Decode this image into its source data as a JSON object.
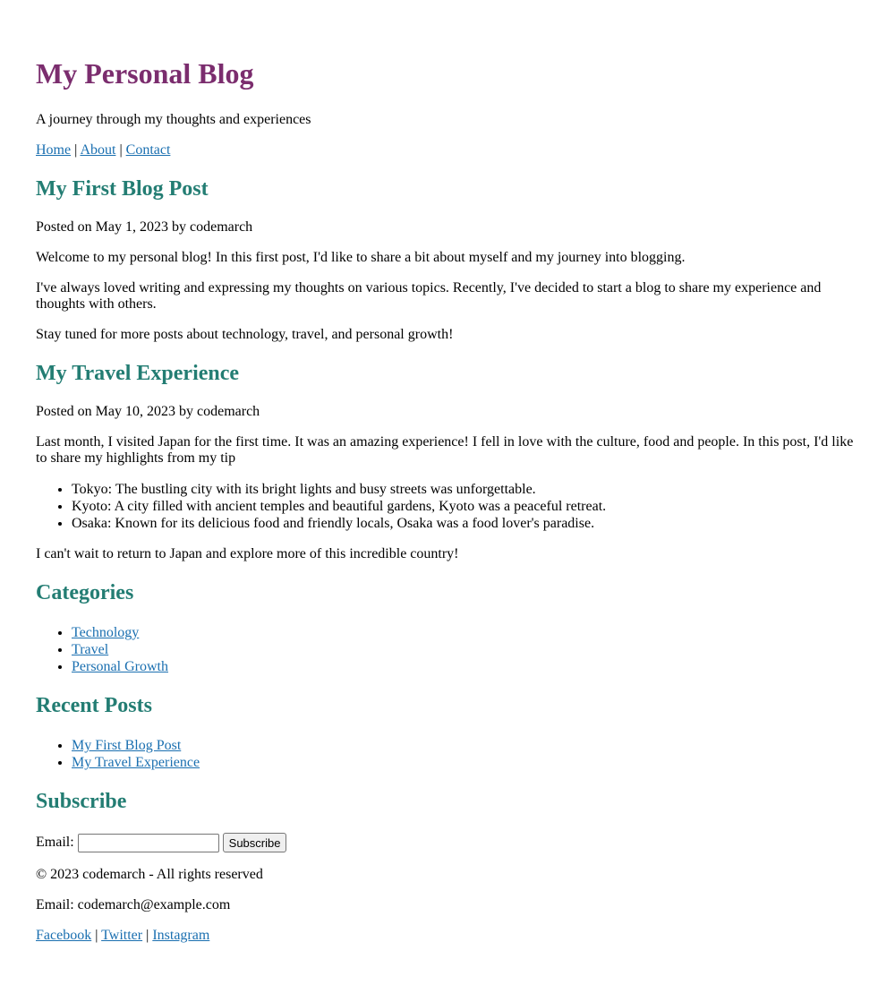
{
  "header": {
    "title": "My Personal Blog",
    "tagline": "A journey through my thoughts and experiences",
    "nav": [
      "Home",
      "About",
      "Contact"
    ],
    "separator": " | "
  },
  "posts": [
    {
      "title": "My First Blog Post",
      "meta": "Posted on May 1, 2023 by codemarch",
      "paragraphs": [
        "Welcome to my personal blog! In this first post, I'd like to share a bit about myself and my journey into blogging.",
        "I've always loved writing and expressing my thoughts on various topics. Recently, I've decided to start a blog to share my experience and thoughts with others.",
        "Stay tuned for more posts about technology, travel, and personal growth!"
      ]
    },
    {
      "title": "My Travel Experience",
      "meta": "Posted on May 10, 2023 by codemarch",
      "intro": "Last month, I visited Japan for the first time. It was an amazing experience! I fell in love with the culture, food and people. In this post, I'd like to share my highlights from my tip",
      "highlights": [
        "Tokyo: The bustling city with its bright lights and busy streets was unforgettable.",
        "Kyoto: A city filled with ancient temples and beautiful gardens, Kyoto was a peaceful retreat.",
        "Osaka: Known for its delicious food and friendly locals, Osaka was a food lover's paradise."
      ],
      "outro": "I can't wait to return to Japan and explore more of this incredible country!"
    }
  ],
  "categories": {
    "heading": "Categories",
    "items": [
      "Technology",
      "Travel",
      "Personal Growth"
    ]
  },
  "recent": {
    "heading": "Recent Posts",
    "items": [
      "My First Blog Post",
      "My Travel Experience"
    ]
  },
  "subscribe": {
    "heading": "Subscribe",
    "label": "Email:",
    "value": "",
    "button": "Subscribe"
  },
  "footer": {
    "copyright": "© 2023 codemarch - All rights reserved",
    "email": "Email: codemarch@example.com",
    "social": [
      "Facebook",
      "Twitter",
      "Instagram"
    ]
  },
  "colors": {
    "title": "#7b2d6e",
    "heading": "#237d73",
    "link": "#1a6fb0"
  }
}
